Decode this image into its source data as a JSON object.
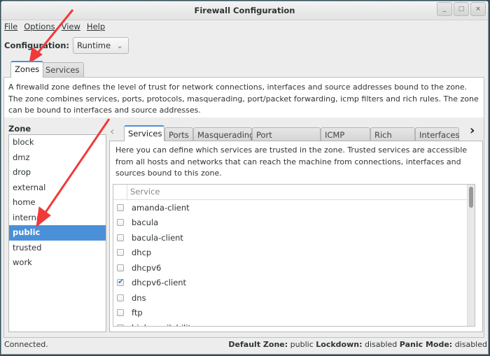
{
  "window": {
    "title": "Firewall Configuration",
    "controls": [
      "_",
      "□",
      "×"
    ]
  },
  "menu": [
    "File",
    "Options",
    "View",
    "Help"
  ],
  "configuration": {
    "label": "Configuration:",
    "value": "Runtime"
  },
  "main_tabs": [
    "Zones",
    "Services"
  ],
  "zones_description": "A firewalld zone defines the level of trust for network connections, interfaces and source addresses bound to the zone. The zone combines services, ports, protocols, masquerading, port/packet forwarding, icmp filters and rich rules. The zone can be bound to interfaces and source addresses.",
  "zone_label": "Zone",
  "zones": [
    "block",
    "dmz",
    "drop",
    "external",
    "home",
    "internal",
    "public",
    "trusted",
    "work"
  ],
  "selected_zone": "public",
  "zone_tabs": [
    "Services",
    "Ports",
    "Masquerading",
    "Port Forwarding",
    "ICMP Filter",
    "Rich Rules",
    "Interfaces"
  ],
  "services_description": "Here you can define which services are trusted in the zone. Trusted services are accessible from all hosts and networks that can reach the machine from connections, interfaces and sources bound to this zone.",
  "service_header": "Service",
  "services": [
    {
      "name": "amanda-client",
      "checked": false
    },
    {
      "name": "bacula",
      "checked": false
    },
    {
      "name": "bacula-client",
      "checked": false
    },
    {
      "name": "dhcp",
      "checked": false
    },
    {
      "name": "dhcpv6",
      "checked": false
    },
    {
      "name": "dhcpv6-client",
      "checked": true
    },
    {
      "name": "dns",
      "checked": false
    },
    {
      "name": "ftp",
      "checked": false
    },
    {
      "name": "high-availability",
      "checked": false
    }
  ],
  "status": {
    "text": "Connected.",
    "default_zone_label": "Default Zone:",
    "default_zone": "public",
    "lockdown_label": "Lockdown:",
    "lockdown": "disabled",
    "panic_label": "Panic Mode:",
    "panic": "disabled"
  },
  "colors": {
    "selection": "#4a90d9",
    "annotation_arrow": "#f03a3a"
  }
}
